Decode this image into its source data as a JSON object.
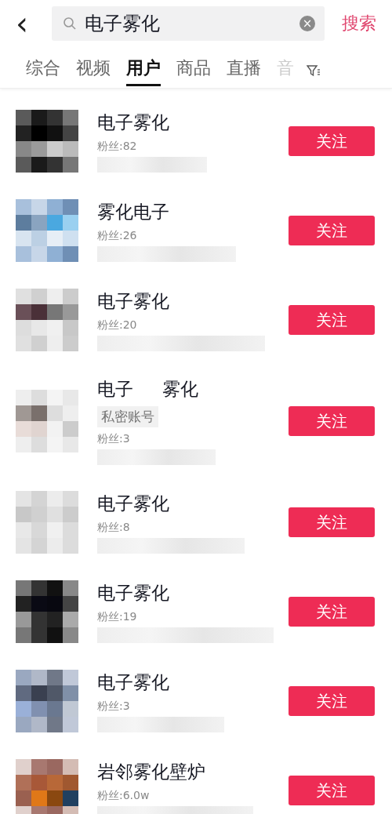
{
  "search": {
    "back": "‹",
    "value": "电子雾化",
    "clear": "×",
    "button": "搜索"
  },
  "tabs": [
    {
      "label": "综合",
      "selected": false,
      "faded": false
    },
    {
      "label": "视频",
      "selected": false,
      "faded": false
    },
    {
      "label": "用户",
      "selected": true,
      "faded": false
    },
    {
      "label": "商品",
      "selected": false,
      "faded": false
    },
    {
      "label": "直播",
      "selected": false,
      "faded": false
    },
    {
      "label": "音",
      "selected": false,
      "faded": true
    }
  ],
  "users": [
    {
      "name": "电子雾化",
      "fans": "粉丝:82",
      "follow": "关注"
    },
    {
      "name": "雾化电子",
      "fans": "粉丝:26",
      "follow": "关注"
    },
    {
      "name": "电子雾化",
      "fans": "粉丝:20",
      "follow": "关注"
    },
    {
      "name": "电子     雾化",
      "tag": "私密账号",
      "fans": "粉丝:3",
      "follow": "关注"
    },
    {
      "name": "电子雾化",
      "fans": "粉丝:8",
      "follow": "关注"
    },
    {
      "name": "电子雾化",
      "fans": "粉丝:19",
      "follow": "关注"
    },
    {
      "name": "电子雾化",
      "fans": "粉丝:3",
      "follow": "关注"
    },
    {
      "name": "岩邻雾化壁炉",
      "fans": "粉丝:6.0w",
      "follow": "关注"
    }
  ]
}
